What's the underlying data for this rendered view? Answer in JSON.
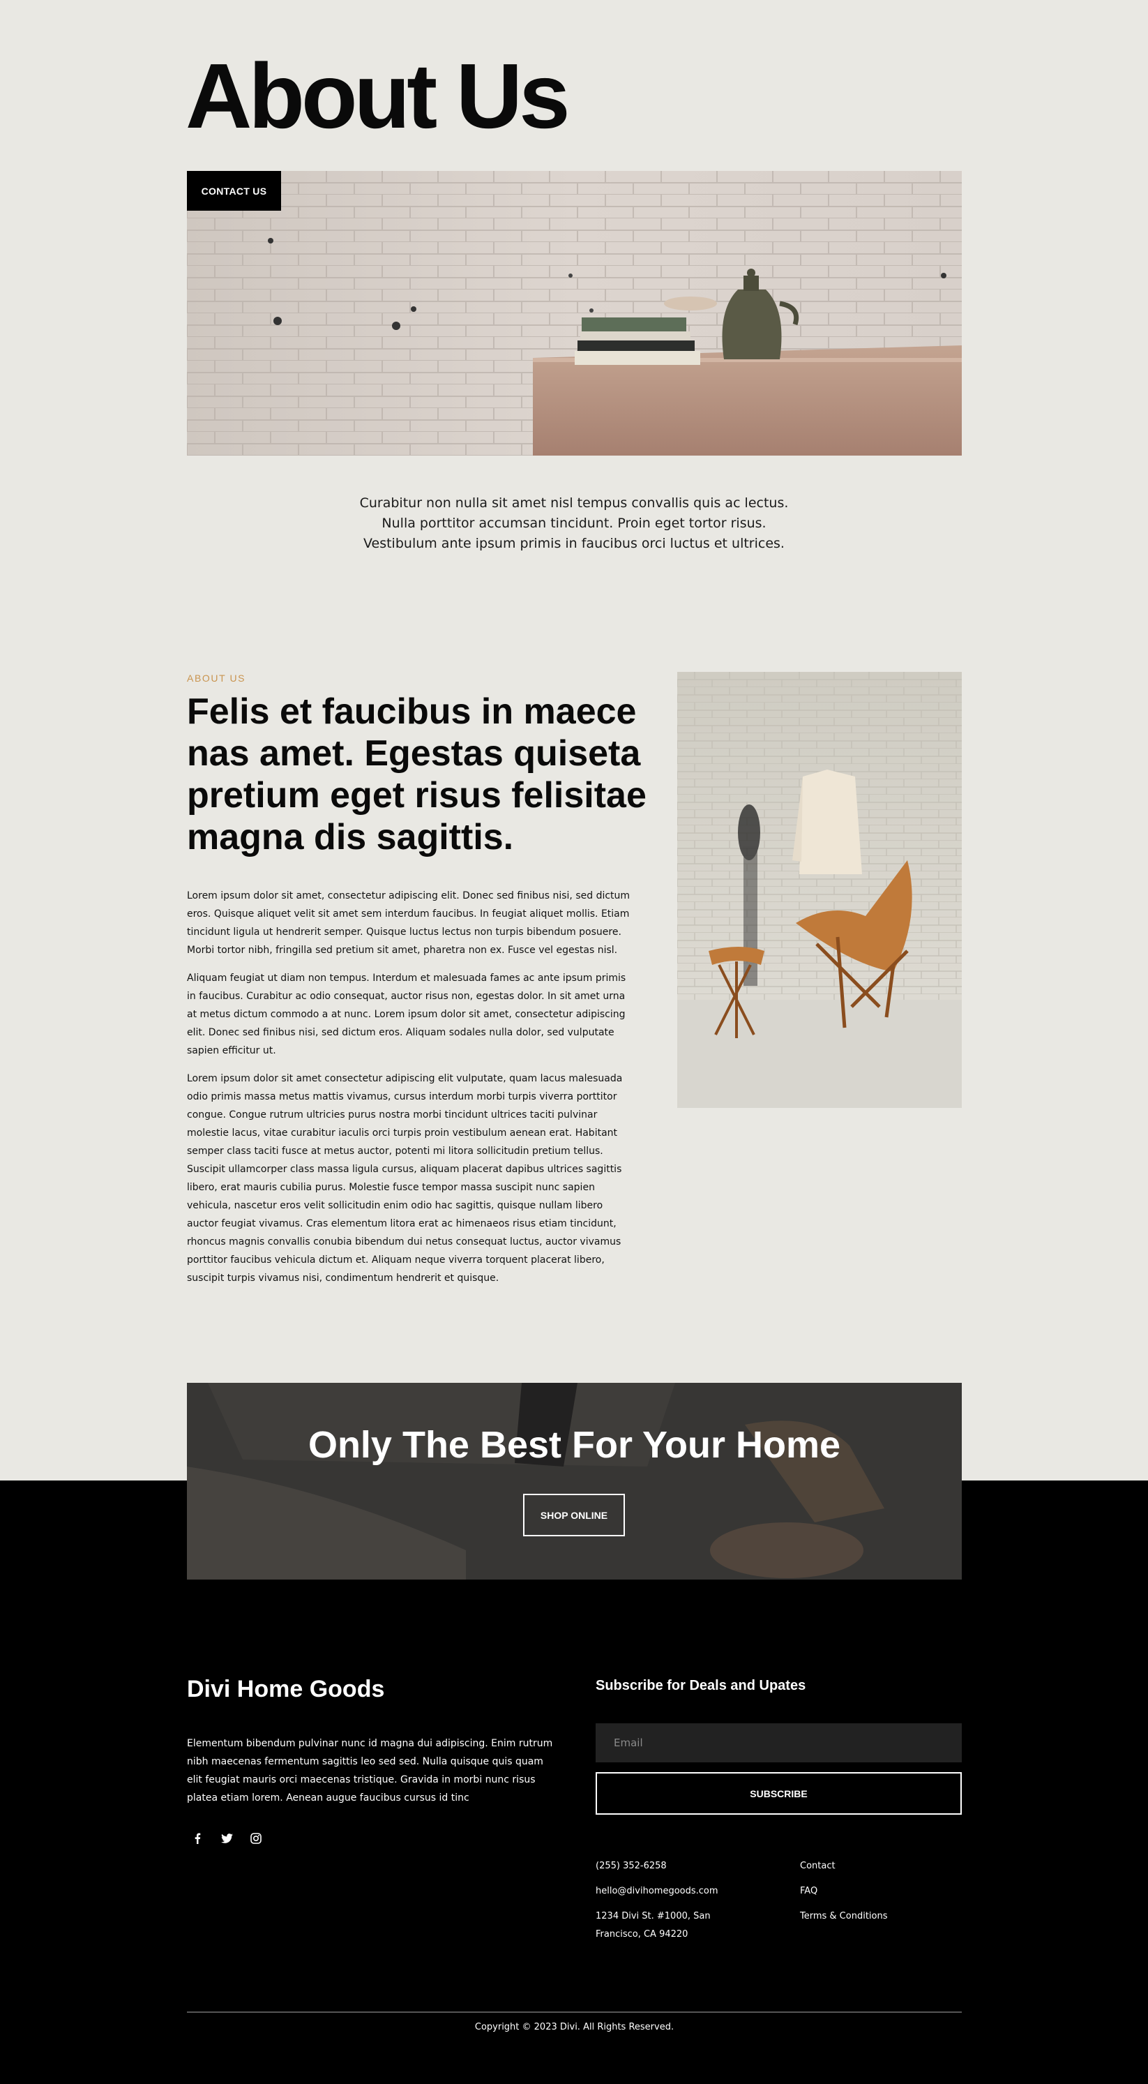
{
  "hero": {
    "title": "About Us",
    "contact_button": "CONTACT US"
  },
  "intro": {
    "lines": [
      "Curabitur non nulla sit amet nisl tempus convallis quis ac lectus.",
      "Nulla porttitor accumsan tincidunt. Proin eget tortor risus.",
      "Vestibulum ante ipsum primis in faucibus orci luctus et ultrices."
    ]
  },
  "about": {
    "eyebrow": "ABOUT US",
    "heading": "Felis et faucibus in maece nas amet. Egestas quiseta pretium eget risus felisitae magna dis sagittis.",
    "paragraphs": [
      "Lorem ipsum dolor sit amet, consectetur adipiscing elit. Donec sed finibus nisi, sed dictum eros. Quisque aliquet velit sit amet sem interdum faucibus. In feugiat aliquet mollis. Etiam tincidunt ligula ut hendrerit semper. Quisque luctus lectus non turpis bibendum posuere. Morbi tortor nibh, fringilla sed pretium sit amet, pharetra non ex. Fusce vel egestas nisl.",
      "Aliquam feugiat ut diam non tempus. Interdum et malesuada fames ac ante ipsum primis in faucibus. Curabitur ac odio consequat, auctor risus non, egestas dolor. In sit amet urna at metus dictum commodo a at nunc. Lorem ipsum dolor sit amet, consectetur adipiscing elit. Donec sed finibus nisi, sed dictum eros. Aliquam sodales nulla dolor, sed vulputate sapien efficitur ut.",
      "Lorem ipsum dolor sit amet consectetur adipiscing elit vulputate, quam lacus malesuada odio primis massa metus mattis vivamus, cursus interdum morbi turpis viverra porttitor congue. Congue rutrum ultricies purus nostra morbi tincidunt ultrices taciti pulvinar molestie lacus, vitae curabitur iaculis orci turpis proin vestibulum aenean erat. Habitant semper class taciti fusce at metus auctor, potenti mi litora sollicitudin pretium tellus. Suscipit ullamcorper class massa ligula cursus, aliquam placerat dapibus ultrices sagittis libero, erat mauris cubilia purus. Molestie fusce tempor massa suscipit nunc sapien vehicula, nascetur eros velit sollicitudin enim odio hac sagittis, quisque nullam libero auctor feugiat vivamus. Cras elementum litora erat ac himenaeos risus etiam tincidunt, rhoncus magnis convallis conubia bibendum dui netus consequat luctus, auctor vivamus porttitor faucibus vehicula dictum et. Aliquam neque viverra torquent placerat libero, suscipit turpis vivamus nisi, condimentum hendrerit et quisque."
    ]
  },
  "cta": {
    "title": "Only The Best For Your Home",
    "button": "SHOP ONLINE"
  },
  "footer": {
    "brand": "Divi Home Goods",
    "description": "Elementum bibendum pulvinar nunc id magna dui adipiscing. Enim rutrum nibh maecenas fermentum sagittis leo sed sed. Nulla quisque quis quam elit feugiat mauris orci maecenas tristique. Gravida in morbi nunc risus platea etiam lorem. Aenean augue faucibus cursus id tinc",
    "social_icons": [
      "facebook-icon",
      "twitter-icon",
      "instagram-icon"
    ],
    "subscribe_title": "Subscribe for Deals and Upates",
    "email_placeholder": "Email",
    "subscribe_button": "SUBSCRIBE",
    "phone": "(255) 352-6258",
    "email": "hello@divihomegoods.com",
    "address_line1": "1234 Divi St. #1000, San",
    "address_line2": "Francisco, CA 94220",
    "links": [
      "Contact",
      "FAQ",
      "Terms & Conditions"
    ],
    "copyright": "Copyright © 2023 Divi. All Rights Reserved."
  },
  "colors": {
    "page_bg": "#e9e8e3",
    "footer_bg": "#000000",
    "accent": "#c9944f"
  }
}
